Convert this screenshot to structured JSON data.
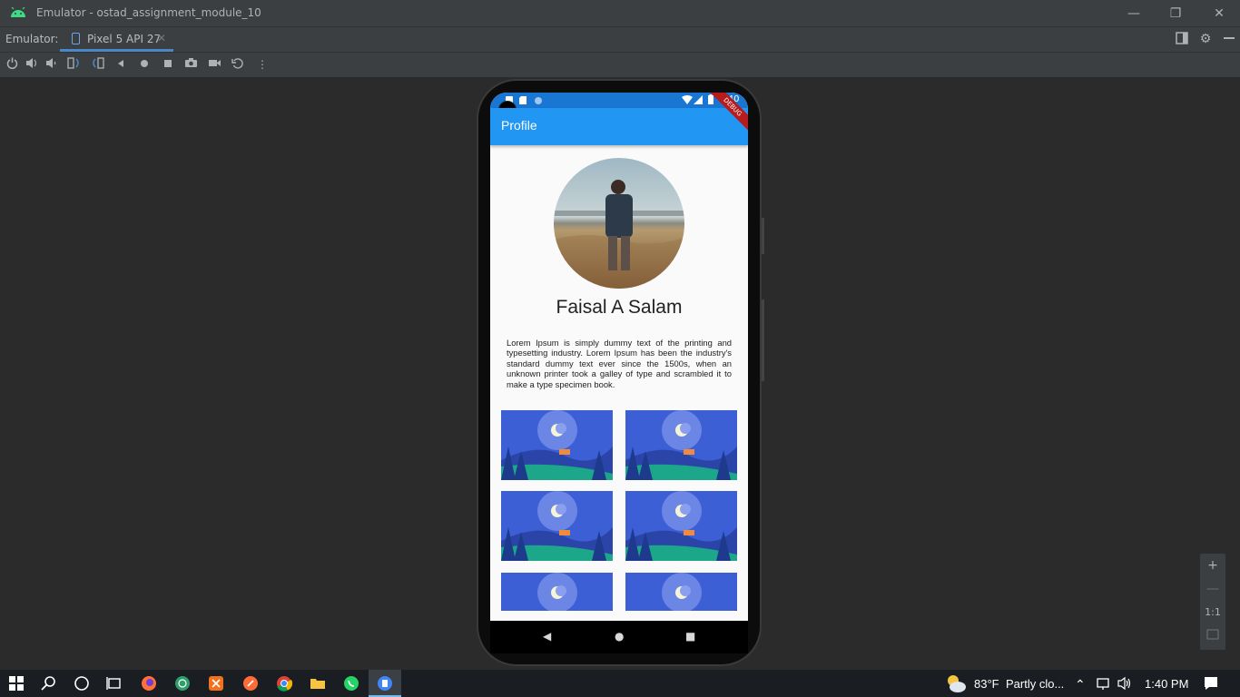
{
  "window": {
    "title": "Emulator - ostad_assignment_module_10",
    "minimize": "—",
    "maximize": "❐",
    "close": "✕"
  },
  "emulator_bar": {
    "label": "Emulator:",
    "device_tab": "Pixel 5 API 27",
    "tab_close": "✕"
  },
  "phone": {
    "status_time": "1:40",
    "debug_banner": "DEBUG",
    "app_title": "Profile",
    "profile_name": "Faisal A Salam",
    "bio": "Lorem Ipsum is simply dummy text of the printing and typesetting industry. Lorem Ipsum has been the industry's standard dummy text ever since the 1500s, when an unknown printer took a galley of type and scrambled it to make a type specimen book.",
    "nav": {
      "back": "◀",
      "home": "●",
      "recents": "■"
    }
  },
  "zoom_panel": {
    "zoom_in": "+",
    "zoom_out": "—",
    "actual_size": "1:1"
  },
  "taskbar": {
    "weather_temp": "83°F",
    "weather_desc": "Partly clo...",
    "clock": "1:40 PM"
  },
  "colors": {
    "app_bar": "#2196f3",
    "status_bar": "#1976d2",
    "ide_background": "#2b2b2b"
  }
}
